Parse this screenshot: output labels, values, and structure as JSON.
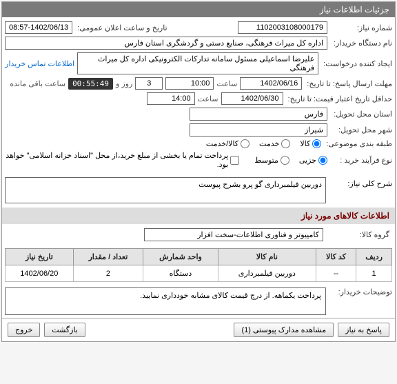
{
  "panel_title": "جزئیات اطلاعات نیاز",
  "labels": {
    "niaz_no": "شماره نیاز:",
    "announce_dt": "تاریخ و ساعت اعلان عمومی:",
    "buyer_org": "نام دستگاه خریدار:",
    "creator": "ایجاد کننده درخواست:",
    "contact": "اطلاعات تماس خریدار",
    "deadline_resp": "مهلت ارسال پاسخ: تا تاریخ:",
    "saat": "ساعت",
    "rooz_va": "روز و",
    "remaining": "ساعت باقی مانده",
    "min_valid": "حداقل تاریخ اعتبار قیمت: تا تاریخ:",
    "province": "استان محل تحویل:",
    "city": "شهر محل تحویل:",
    "subject_cat": "طبقه بندی موضوعی:",
    "buy_process": "نوع فرآیند خرید :",
    "payment_note": "پرداخت تمام یا بخشی از مبلغ خرید،از محل \"اسناد خزانه اسلامی\" خواهد بود.",
    "sharh": "شرح کلی نیاز:",
    "items_section": "اطلاعات کالاهای مورد نیاز",
    "group": "گروه کالا:",
    "buyer_notes": "توضیحات خریدار:"
  },
  "values": {
    "niaz_no": "1102003108000179",
    "announce_date": "1402/06/13",
    "announce_time": "08:57",
    "buyer_org": "اداره کل میراث فرهنگی، صنایع دستی و گردشگری استان فارس",
    "creator": "علیرضا اسماعیلی مسئول سامانه تدارکات الکترونیکی اداره کل میراث فرهنگی",
    "deadline_date": "1402/06/16",
    "deadline_time": "10:00",
    "days_left": "3",
    "countdown": "00:55:49",
    "valid_date": "1402/06/30",
    "valid_time": "14:00",
    "province": "فارس",
    "city": "شیراز",
    "sharh": "دوربین فیلمبرداری گو پرو بشرح پیوست",
    "group": "کامپیوتر و فناوری اطلاعات-سخت افزار",
    "buyer_notes": "پرداخت یکماهه. از درج قیمت کالای مشابه خودداری نمایید."
  },
  "subject_options": {
    "kala": "کالا",
    "khadamat": "خدمت",
    "both": "کالا/خدمت"
  },
  "process_options": {
    "jozei": "جزیی",
    "motevaset": "متوسط"
  },
  "table": {
    "headers": [
      "ردیف",
      "کد کالا",
      "نام کالا",
      "واحد شمارش",
      "تعداد / مقدار",
      "تاریخ نیاز"
    ],
    "rows": [
      [
        "1",
        "--",
        "دوربین فیلمبرداری",
        "دستگاه",
        "2",
        "1402/06/20"
      ]
    ]
  },
  "buttons": {
    "respond": "پاسخ به نیاز",
    "attachments": "مشاهده مدارک پیوستی (1)",
    "back": "بازگشت",
    "exit": "خروج"
  }
}
